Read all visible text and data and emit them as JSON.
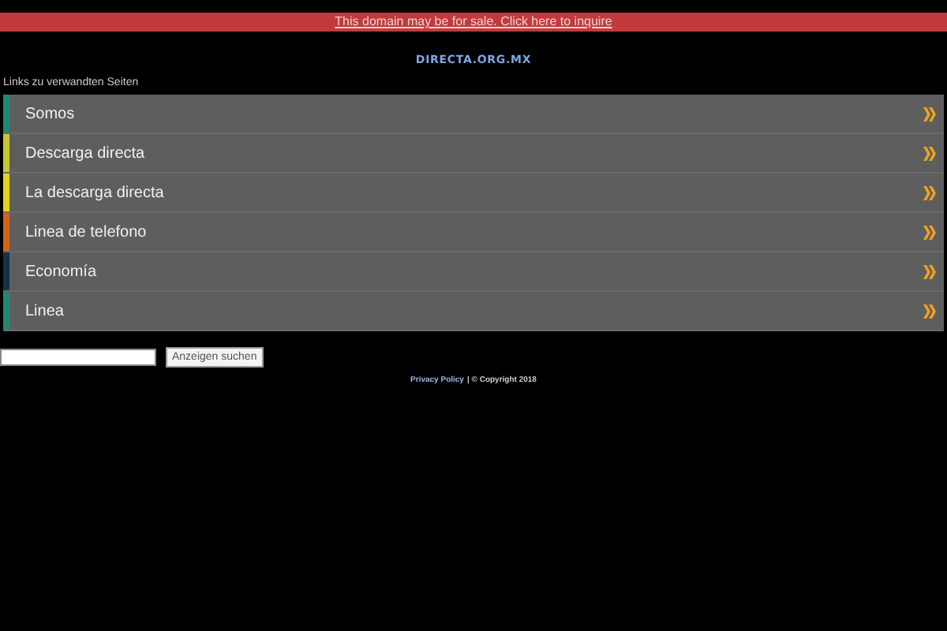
{
  "banner": {
    "link": "This domain may be for sale. Click here to inquire"
  },
  "logo": "DIRECTA.ORG.MX",
  "section_title": "Links zu verwandten Seiten",
  "links": [
    {
      "label": "Somos",
      "color": "#1f8a70"
    },
    {
      "label": "Descarga directa",
      "color": "#c8c832"
    },
    {
      "label": "La descarga directa",
      "color": "#e8d020"
    },
    {
      "label": "Linea de telefono",
      "color": "#d0651a"
    },
    {
      "label": "Economía",
      "color": "#15324a"
    },
    {
      "label": "Linea",
      "color": "#1f8a70"
    }
  ],
  "search": {
    "button": "Anzeigen suchen"
  },
  "footer": {
    "privacy": "Privacy Policy",
    "copyright": "| © Copyright 2018"
  }
}
